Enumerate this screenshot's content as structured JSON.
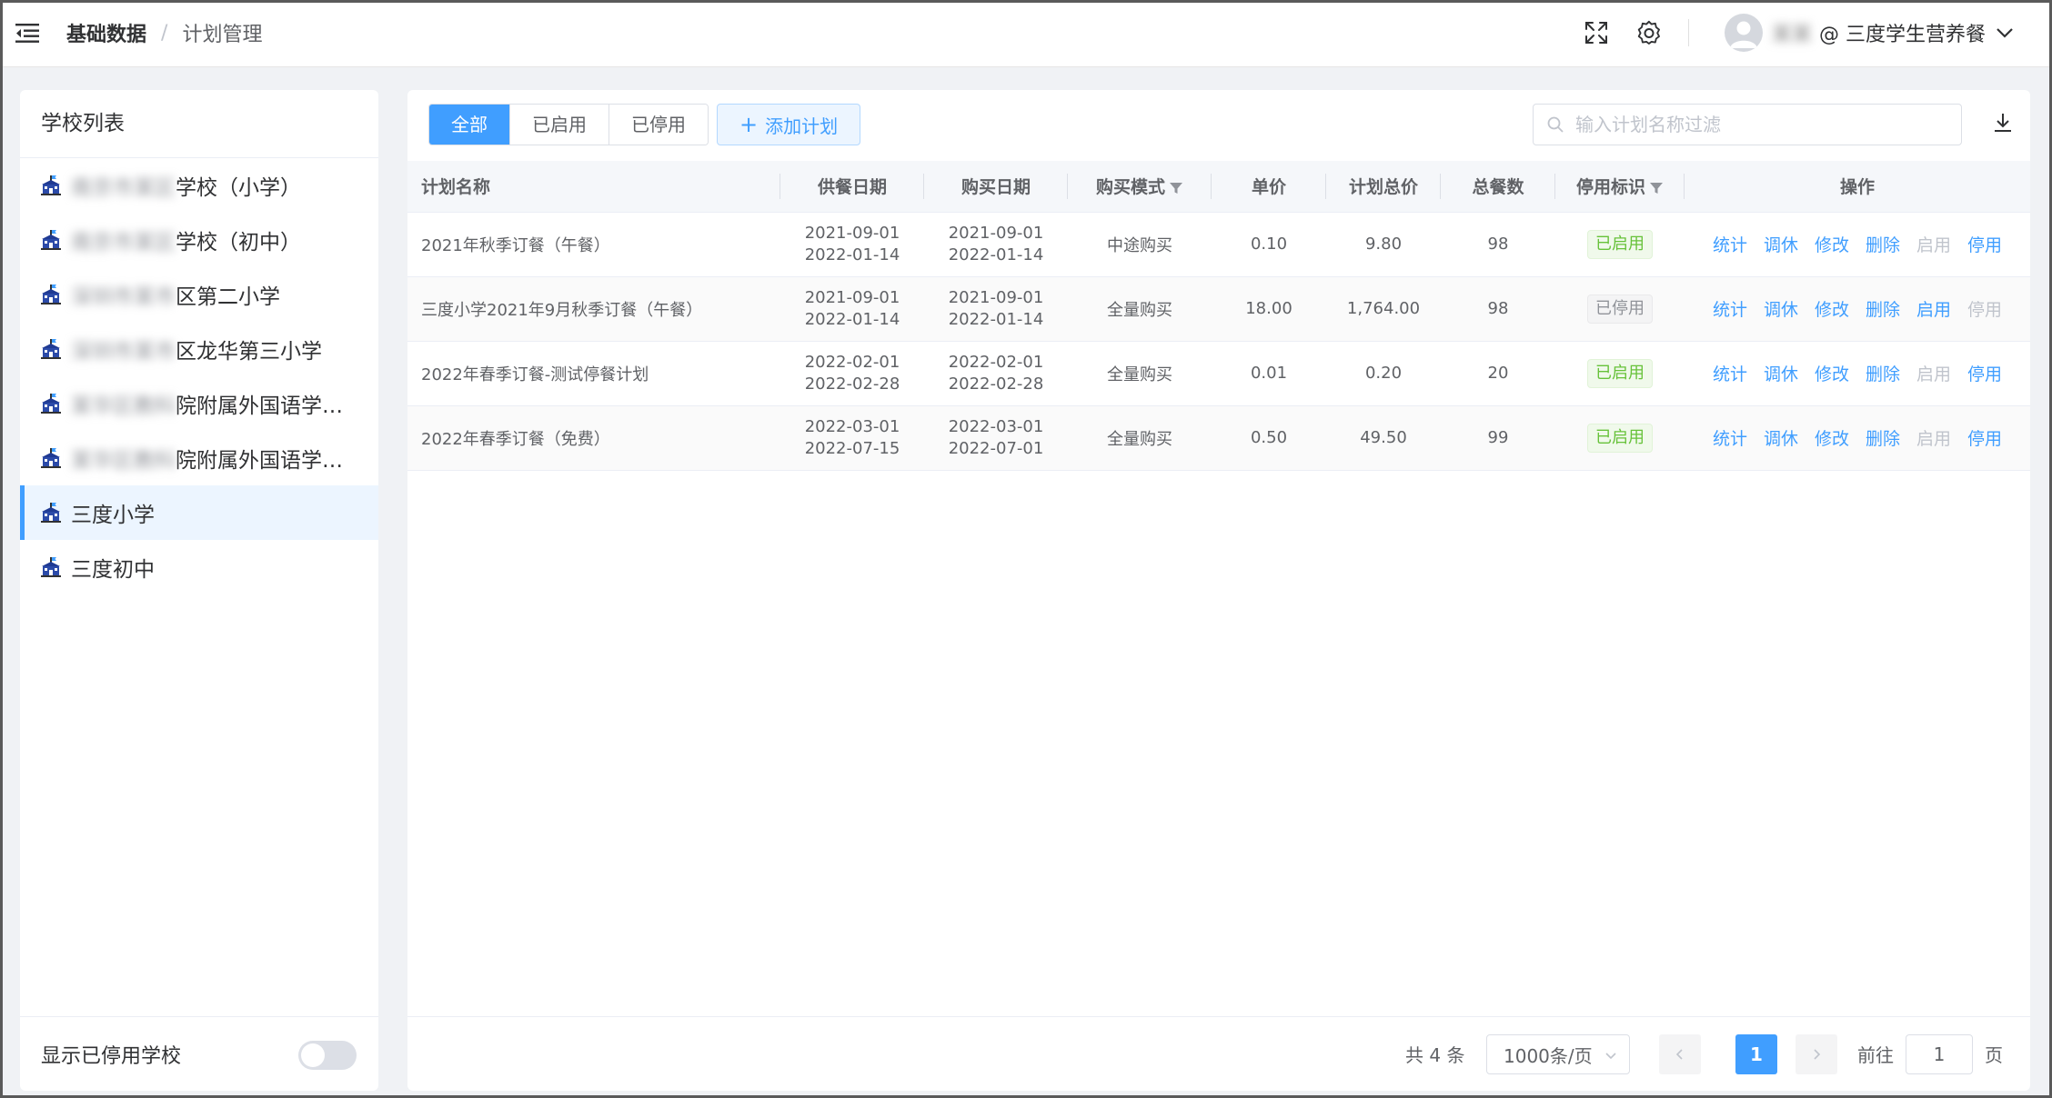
{
  "header": {
    "breadcrumb": [
      "基础数据",
      "计划管理"
    ],
    "user_name": "某某",
    "user_org": "@ 三度学生营养餐"
  },
  "sidebar": {
    "title": "学校列表",
    "schools": [
      {
        "prefix": "南京市某区",
        "name": "学校（小学）",
        "active": false
      },
      {
        "prefix": "南京市某区",
        "name": "学校（初中）",
        "active": false
      },
      {
        "prefix": "深圳市某市",
        "name": "区第二小学",
        "active": false
      },
      {
        "prefix": "深圳市某市",
        "name": "区龙华第三小学",
        "active": false
      },
      {
        "prefix": "某华区教科",
        "name": "院附属外国语学校…",
        "active": false
      },
      {
        "prefix": "某华区教科",
        "name": "院附属外国语学校…",
        "active": false
      },
      {
        "prefix": "",
        "name": "三度小学",
        "active": true
      },
      {
        "prefix": "",
        "name": "三度初中",
        "active": false
      }
    ],
    "toggle_label": "显示已停用学校",
    "toggle_on": false
  },
  "toolbar": {
    "tabs": [
      "全部",
      "已启用",
      "已停用"
    ],
    "active_tab": "全部",
    "add_label": "添加计划",
    "search_placeholder": "输入计划名称过滤",
    "search_value": ""
  },
  "table": {
    "columns": [
      "计划名称",
      "供餐日期",
      "购买日期",
      "购买模式",
      "单价",
      "计划总价",
      "总餐数",
      "停用标识",
      "操作"
    ],
    "rows": [
      {
        "name": "2021年秋季订餐（午餐）",
        "supply_start": "2021-09-01",
        "supply_end": "2022-01-14",
        "buy_start": "2021-09-01",
        "buy_end": "2022-01-14",
        "mode": "中途购买",
        "price": "0.10",
        "total": "9.80",
        "count": "98",
        "status": "已启用",
        "enabled": true
      },
      {
        "name": "三度小学2021年9月秋季订餐（午餐）",
        "supply_start": "2021-09-01",
        "supply_end": "2022-01-14",
        "buy_start": "2021-09-01",
        "buy_end": "2022-01-14",
        "mode": "全量购买",
        "price": "18.00",
        "total": "1,764.00",
        "count": "98",
        "status": "已停用",
        "enabled": false
      },
      {
        "name": "2022年春季订餐-测试停餐计划",
        "supply_start": "2022-02-01",
        "supply_end": "2022-02-28",
        "buy_start": "2022-02-01",
        "buy_end": "2022-02-28",
        "mode": "全量购买",
        "price": "0.01",
        "total": "0.20",
        "count": "20",
        "status": "已启用",
        "enabled": true
      },
      {
        "name": "2022年春季订餐（免费）",
        "supply_start": "2022-03-01",
        "supply_end": "2022-07-15",
        "buy_start": "2022-03-01",
        "buy_end": "2022-07-01",
        "mode": "全量购买",
        "price": "0.50",
        "total": "49.50",
        "count": "99",
        "status": "已启用",
        "enabled": true
      }
    ],
    "actions": [
      "统计",
      "调休",
      "修改",
      "删除",
      "启用",
      "停用"
    ]
  },
  "pagination": {
    "total_text": "共 4 条",
    "page_size": "1000条/页",
    "current_page": "1",
    "goto_prefix": "前往",
    "goto_value": "1",
    "goto_suffix": "页"
  },
  "colors": {
    "primary": "#409eff",
    "enabled_tag": "#67c23a",
    "disabled_tag": "#909399"
  }
}
